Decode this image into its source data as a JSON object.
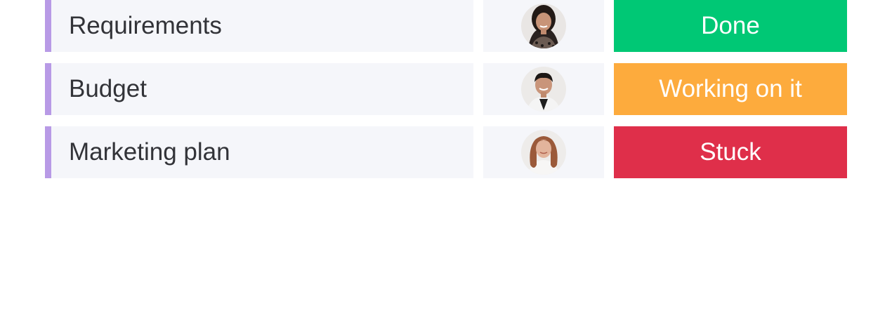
{
  "colors": {
    "row_accent": "#a25ddc",
    "row_accent_light": "#b89ae6",
    "cell_background": "#f5f6fa",
    "text": "#323338"
  },
  "rows": [
    {
      "name": "Requirements",
      "person": {
        "icon": "avatar-woman-dark-hair"
      },
      "status": {
        "label": "Done",
        "color": "#00c875"
      }
    },
    {
      "name": "Budget",
      "person": {
        "icon": "avatar-man-dark-hair"
      },
      "status": {
        "label": "Working on it",
        "color": "#fdab3d"
      }
    },
    {
      "name": "Marketing plan",
      "person": {
        "icon": "avatar-woman-red-hair"
      },
      "status": {
        "label": "Stuck",
        "color": "#df2f4a"
      }
    }
  ]
}
